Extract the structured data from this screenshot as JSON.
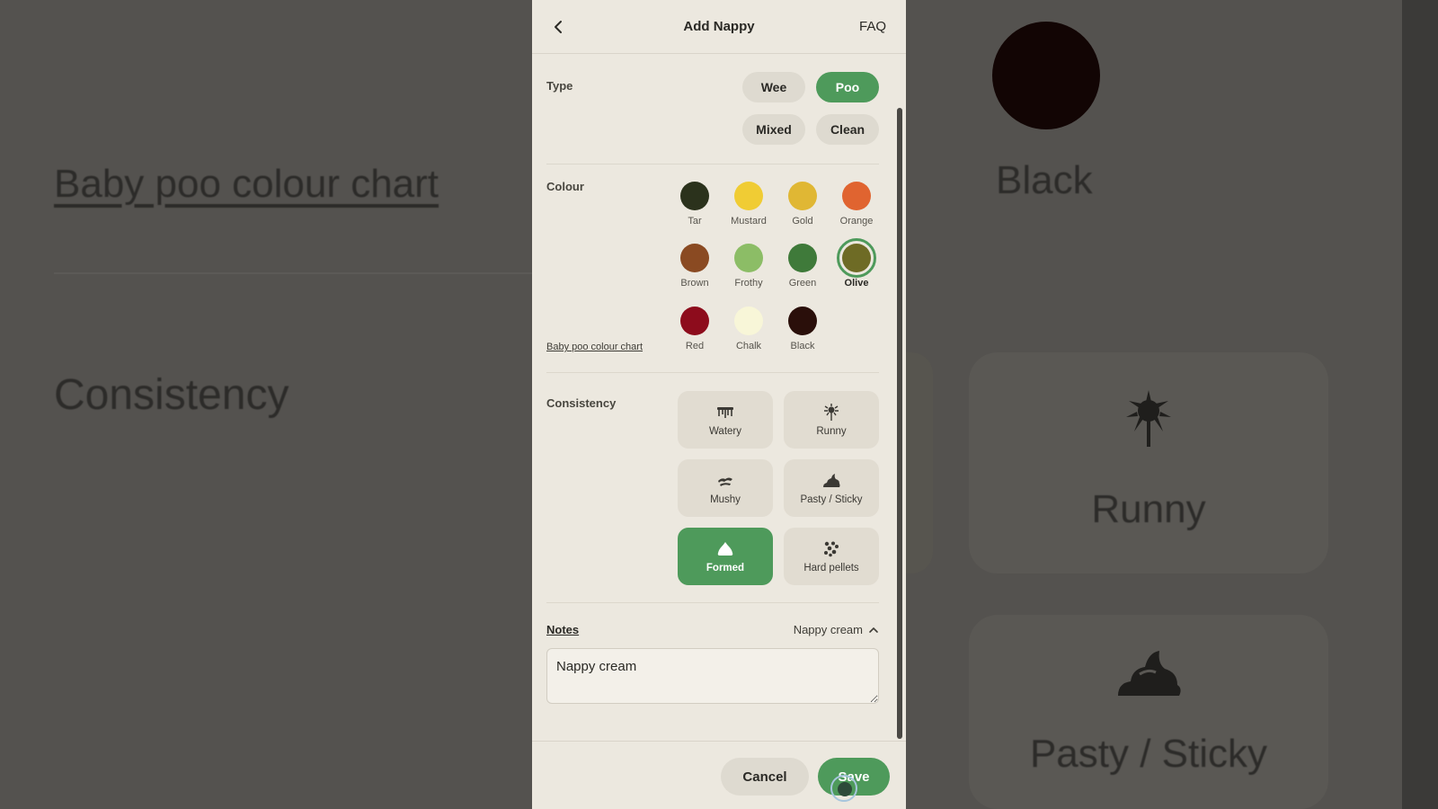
{
  "background": {
    "chart_link": "Baby poo colour chart",
    "consistency_heading": "Consistency",
    "black_label": "Black",
    "card_runny": "Runny",
    "card_pasty": "Pasty / Sticky"
  },
  "header": {
    "title": "Add Nappy",
    "faq": "FAQ"
  },
  "type": {
    "label": "Type",
    "options": [
      "Wee",
      "Poo",
      "Mixed",
      "Clean"
    ],
    "selected": "Poo"
  },
  "colour": {
    "label": "Colour",
    "chart_link": "Baby poo colour chart",
    "selected": "Olive",
    "swatches": [
      {
        "name": "Tar",
        "color": "#2b321c"
      },
      {
        "name": "Mustard",
        "color": "#f0cc34"
      },
      {
        "name": "Gold",
        "color": "#e0b734"
      },
      {
        "name": "Orange",
        "color": "#e06430"
      },
      {
        "name": "Brown",
        "color": "#8a4a22"
      },
      {
        "name": "Frothy",
        "color": "#8cbd66"
      },
      {
        "name": "Green",
        "color": "#3f7a3a"
      },
      {
        "name": "Olive",
        "color": "#6e6b25"
      },
      {
        "name": "Red",
        "color": "#8d0c1c"
      },
      {
        "name": "Chalk",
        "color": "#f8f6d8"
      },
      {
        "name": "Black",
        "color": "#2a0f0a"
      }
    ]
  },
  "consistency": {
    "label": "Consistency",
    "selected": "Formed",
    "options": [
      {
        "name": "Watery",
        "icon": "watery-icon"
      },
      {
        "name": "Runny",
        "icon": "runny-icon"
      },
      {
        "name": "Mushy",
        "icon": "mushy-icon"
      },
      {
        "name": "Pasty / Sticky",
        "icon": "pasty-icon"
      },
      {
        "name": "Formed",
        "icon": "formed-icon"
      },
      {
        "name": "Hard pellets",
        "icon": "pellets-icon"
      }
    ]
  },
  "notes": {
    "label": "Notes",
    "toggle": "Nappy cream",
    "value": "Nappy cream"
  },
  "footer": {
    "cancel": "Cancel",
    "save": "Save"
  },
  "colors": {
    "accent": "#4e9a5b",
    "panel": "#ece8df",
    "pill": "#dedad0"
  }
}
